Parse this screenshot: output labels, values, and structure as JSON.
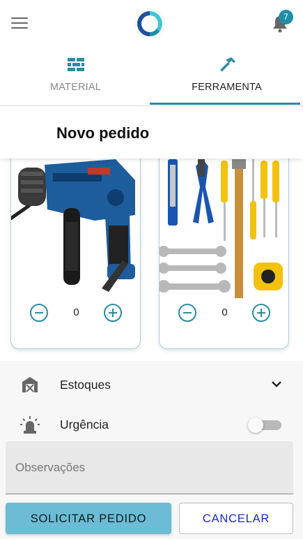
{
  "header": {
    "menu_icon": "hamburger-icon",
    "logo_icon": "app-logo",
    "notification_icon": "bell-icon",
    "notification_count": "7"
  },
  "tabs": [
    {
      "label": "MATERIAL",
      "icon": "brick-wall-icon",
      "active": false
    },
    {
      "label": "FERRAMENTA",
      "icon": "hammer-icon",
      "active": true
    }
  ],
  "page": {
    "title": "Novo pedido"
  },
  "products": [
    {
      "image": "power-drill-image",
      "quantity": "0"
    },
    {
      "image": "tool-set-image",
      "quantity": "0"
    }
  ],
  "form": {
    "estoques": {
      "label": "Estoques",
      "icon": "warehouse-icon"
    },
    "urgencia": {
      "label": "Urgência",
      "icon": "siren-icon",
      "enabled": false
    },
    "observacoes_placeholder": "Observações",
    "observacoes_value": ""
  },
  "actions": {
    "submit_label": "SOLICITAR PEDIDO",
    "cancel_label": "CANCELAR"
  },
  "colors": {
    "accent": "#2a8ca4",
    "submit_bg": "#6bbcd4",
    "cancel_text": "#1a28c8",
    "badge_bg": "#1f8fa8"
  }
}
